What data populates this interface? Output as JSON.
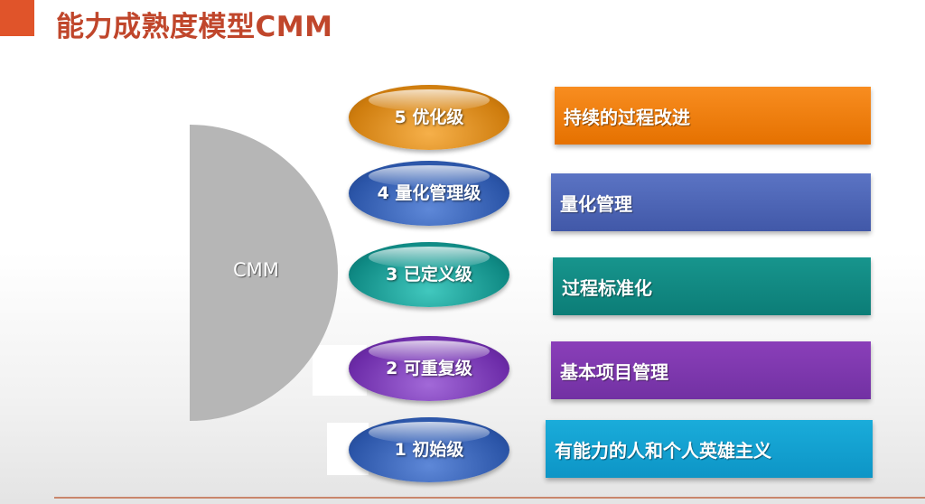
{
  "title": "能力成熟度模型CMM",
  "center_label": "CMM",
  "levels": [
    {
      "label": "5 优化级",
      "description": "持续的过程改进"
    },
    {
      "label": "4 量化管理级",
      "description": "量化管理"
    },
    {
      "label": "3 已定义级",
      "description": "过程标准化"
    },
    {
      "label": "2 可重复级",
      "description": "基本项目管理"
    },
    {
      "label": "1 初始级",
      "description": "有能力的人和个人英雄主义"
    }
  ],
  "colors": {
    "title": "#c0462b",
    "title_bar": "#e0542a",
    "half_circle": "#b6b6b6",
    "level5": "#cf7d0e",
    "level4": "#2b55a8",
    "level3": "#0f8a84",
    "level2": "#6d2ca9",
    "level1": "#2b55a8",
    "desc5": "#f07f0c",
    "desc4": "#4d66b6",
    "desc3": "#128a83",
    "desc2": "#7f38ae",
    "desc1": "#14a1d0"
  }
}
